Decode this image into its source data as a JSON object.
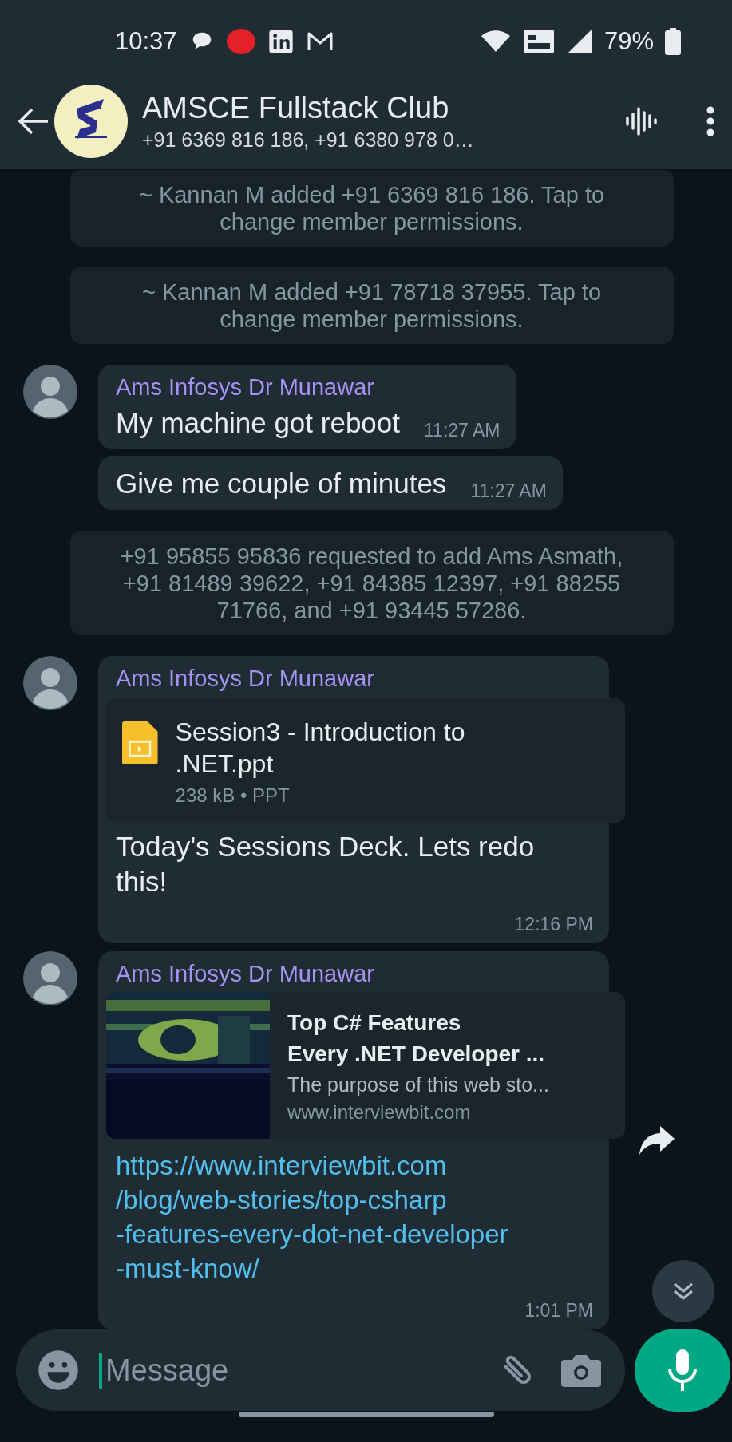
{
  "status_bar": {
    "time": "10:37",
    "battery": "79%"
  },
  "header": {
    "title": "AMSCE Fullstack Club",
    "subtitle": "+91 6369 816 186, +91 6380 978 0…"
  },
  "messages": [
    {
      "kind": "system",
      "text": "~ Kannan M added +91 6369 816 186. Tap to change member permissions."
    },
    {
      "kind": "system",
      "text": "~ Kannan M added +91 78718 37955. Tap to change member permissions."
    },
    {
      "kind": "text",
      "sender": "Ams Infosys Dr Munawar",
      "text": "My machine got reboot",
      "time": "11:27 AM"
    },
    {
      "kind": "text",
      "text": "Give me couple of minutes",
      "time": "11:27 AM"
    },
    {
      "kind": "system",
      "text": "+91 95855 95836 requested to add Ams Asmath, +91 81489 39622, +91 84385 12397, +91 88255 71766, and +91 93445 57286."
    },
    {
      "kind": "document",
      "sender": "Ams Infosys Dr Munawar",
      "file": {
        "name": "Session3 - Introduction to .NET.ppt",
        "meta": "238 kB • PPT"
      },
      "text": "Today's Sessions Deck. Lets redo this!",
      "time": "12:16 PM"
    },
    {
      "kind": "link",
      "sender": "Ams Infosys Dr Munawar",
      "preview": {
        "kind": "picture",
        "title_lines": [
          "Top C# Features",
          "Every .NET Developer ..."
        ],
        "description": "The purpose of this web sto...",
        "domain": "www.interviewbit.com"
      },
      "url_lines": [
        "https://www.interviewbit.com",
        "/blog/web-stories/top-csharp",
        "-features-every-dot-net-developer",
        "-must-know/"
      ],
      "time": "1:01 PM",
      "forward": true
    }
  ],
  "composer": {
    "placeholder": "Message"
  }
}
